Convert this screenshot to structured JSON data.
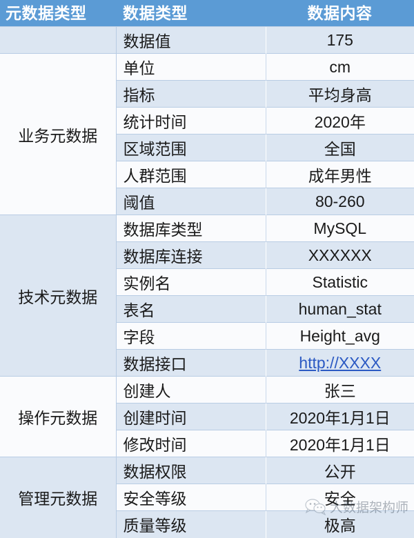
{
  "header": {
    "group_label": "元数据类型",
    "type_label": "数据类型",
    "value_label": "数据内容"
  },
  "groups": {
    "business": "业务元数据",
    "technical": "技术元数据",
    "operational": "操作元数据",
    "management": "管理元数据"
  },
  "rows": [
    {
      "type": "数据值",
      "value": "175"
    },
    {
      "type": "单位",
      "value": "cm"
    },
    {
      "type": "指标",
      "value": "平均身高"
    },
    {
      "type": "统计时间",
      "value": "2020年"
    },
    {
      "type": "区域范围",
      "value": "全国"
    },
    {
      "type": "人群范围",
      "value": "成年男性"
    },
    {
      "type": "阈值",
      "value": "80-260"
    },
    {
      "type": "数据库类型",
      "value": "MySQL"
    },
    {
      "type": "数据库连接",
      "value": "XXXXXX"
    },
    {
      "type": "实例名",
      "value": "Statistic"
    },
    {
      "type": "表名",
      "value": "human_stat"
    },
    {
      "type": "字段",
      "value": "Height_avg"
    },
    {
      "type": "数据接口",
      "value": "http://XXXX"
    },
    {
      "type": "创建人",
      "value": "张三"
    },
    {
      "type": "创建时间",
      "value": "2020年1月1日"
    },
    {
      "type": "修改时间",
      "value": "2020年1月1日"
    },
    {
      "type": "数据权限",
      "value": "公开"
    },
    {
      "type": "安全等级",
      "value": "安全"
    },
    {
      "type": "质量等级",
      "value": "极高"
    }
  ],
  "watermark": {
    "text": "大数据架构师",
    "logo": "wechat-logo"
  },
  "colors": {
    "header_bg": "#5B9BD5",
    "header_text": "#FFFFFF",
    "band_bg": "#DCE6F2",
    "row_bg": "#FAFBFD",
    "border": "#B8CCE4",
    "link": "#2B59C3"
  }
}
